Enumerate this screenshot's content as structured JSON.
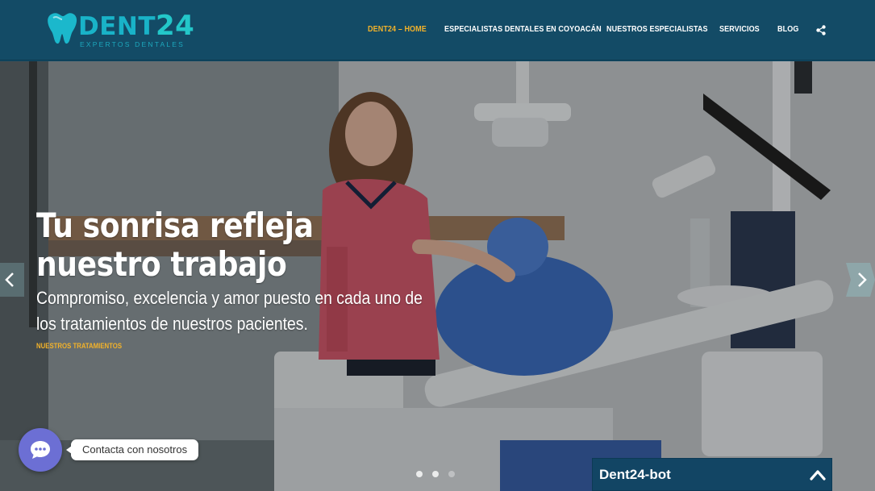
{
  "header": {
    "logo": {
      "word_part1": "DENT",
      "word_part2": "24",
      "tagline": "EXPERTOS DENTALES"
    },
    "nav": [
      {
        "label": "DENT24 – HOME",
        "active": true
      },
      {
        "label": "ESPECIALISTAS DENTALES EN COYOACÁN",
        "active": false
      },
      {
        "label": "NUESTROS ESPECIALISTAS",
        "active": false
      },
      {
        "label": "SERVICIOS",
        "active": false
      },
      {
        "label": "BLOG",
        "active": false
      }
    ],
    "share_icon": "share-icon"
  },
  "hero": {
    "title": "Tu sonrisa refleja nuestro trabajo",
    "subtitle": "Compromiso, excelencia y amor puesto en cada uno de los tratamientos de nuestros pacientes.",
    "cta": "NUESTROS TRATAMIENTOS",
    "prev_icon": "chevron-left-icon",
    "next_icon": "chevron-right-icon",
    "slide_count": 3,
    "active_slide": 3
  },
  "chat": {
    "button_icon": "chat-bubble-icon",
    "label": "Contacta con nosotros"
  },
  "bot": {
    "title": "Dent24-bot",
    "toggle_icon": "chevron-up-icon"
  },
  "colors": {
    "header_bg": "#134b66",
    "accent": "#f2b22a",
    "logo_teal": "#19b3c8",
    "chat_purple": "#6c6fd4",
    "bot_bar": "#124564"
  }
}
